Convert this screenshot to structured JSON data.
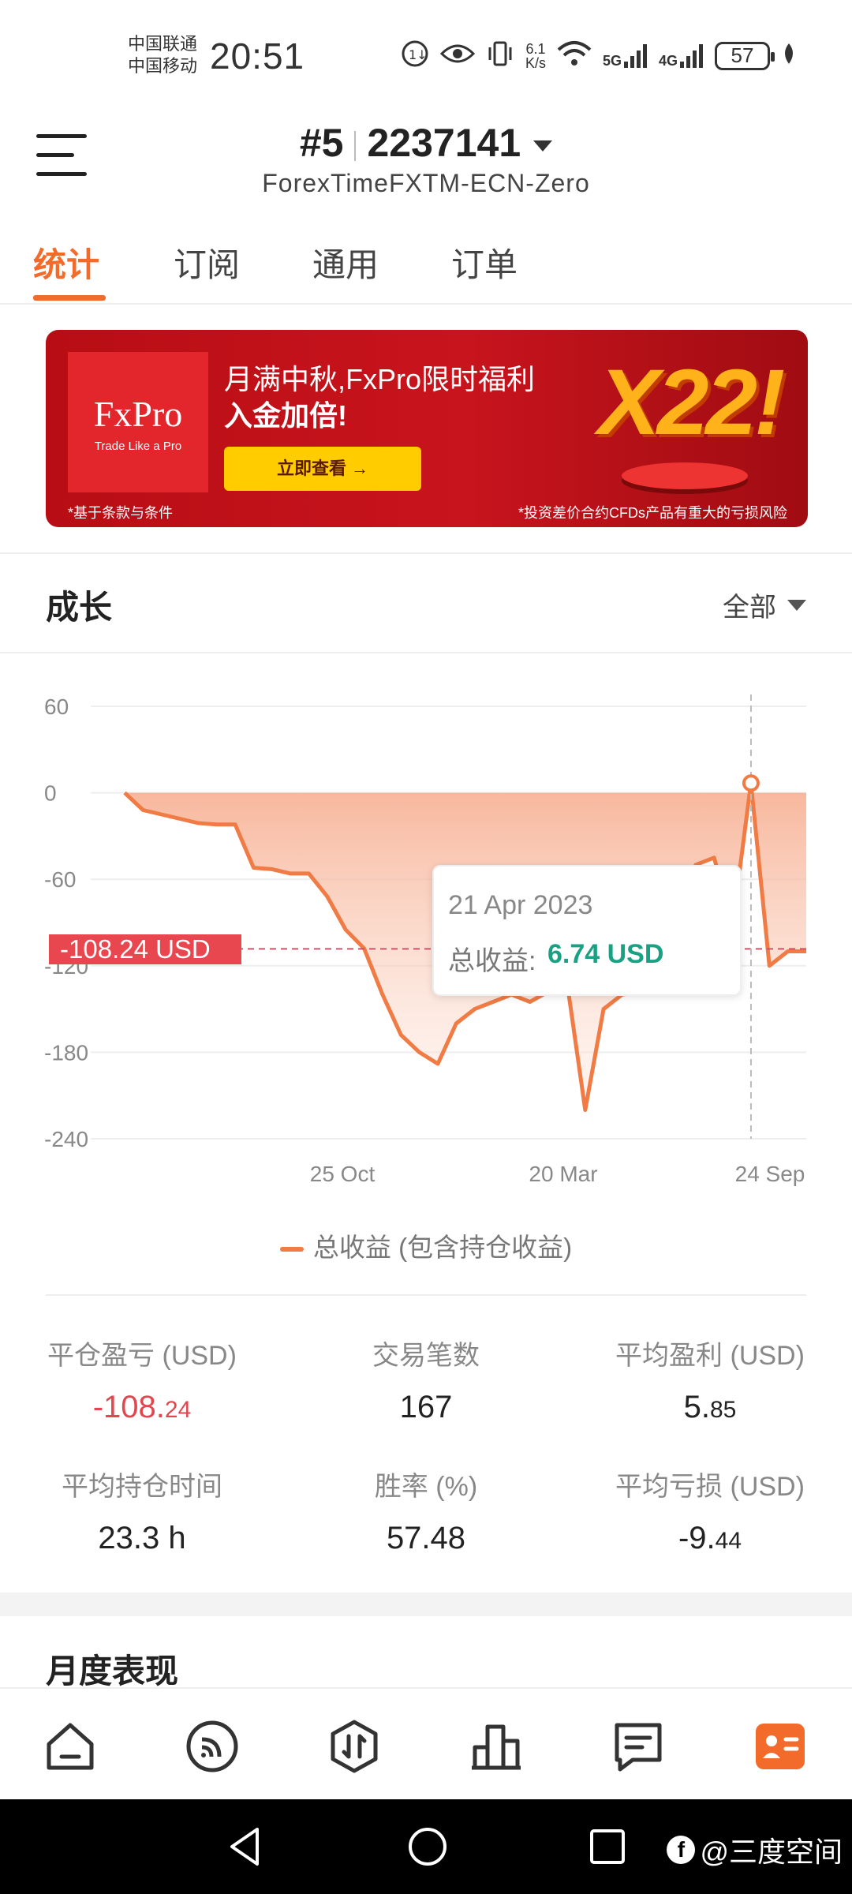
{
  "status_bar": {
    "carrier1": "中国联通",
    "carrier2": "中国移动",
    "time": "20:51",
    "net_speed_value": "6.1",
    "net_speed_unit": "K/s",
    "signal1": "5G",
    "signal2": "4G",
    "battery": "57"
  },
  "header": {
    "account_num": "#5",
    "account_id": "2237141",
    "broker": "ForexTimeFXTM-ECN-Zero"
  },
  "tabs": [
    {
      "label": "统计",
      "active": true
    },
    {
      "label": "订阅",
      "active": false
    },
    {
      "label": "通用",
      "active": false
    },
    {
      "label": "订单",
      "active": false
    }
  ],
  "banner": {
    "logo": "FxPro",
    "logo_tag": "Trade Like a Pro",
    "line1": "月满中秋,FxPro限时福利",
    "line2": "入金加倍!",
    "button": "立即查看 →",
    "terms": "*基于条款与条件",
    "risk": "*投资差价合约CFDs产品有重大的亏损风险",
    "promo": "X22!"
  },
  "growth": {
    "title": "成长",
    "filter": "全部",
    "price_tag": "-108.24 USD",
    "tooltip": {
      "date": "21 Apr 2023",
      "label": "总收益:",
      "value": "6.74 USD"
    },
    "legend": "总收益 (包含持仓收益)"
  },
  "chart_data": {
    "type": "area",
    "title": "",
    "xlabel": "",
    "ylabel": "",
    "ylim": [
      -240,
      60
    ],
    "y_ticks": [
      "60",
      "0",
      "-60",
      "-120",
      "-180",
      "-240"
    ],
    "x_tick_labels": [
      "25 Oct",
      "20 Mar",
      "24 Sep"
    ],
    "grid": true,
    "reference_line": -108.24,
    "highlight": {
      "x_label": "21 Apr 2023",
      "value": 6.74
    },
    "series": [
      {
        "name": "总收益 (包含持仓收益)",
        "color": "#f07b45",
        "values": [
          0,
          -12,
          -15,
          -18,
          -21,
          -22,
          -22,
          -52,
          -53,
          -56,
          -56,
          -72,
          -95,
          -108,
          -140,
          -168,
          -180,
          -188,
          -160,
          -150,
          -145,
          -140,
          -145,
          -138,
          -130,
          -220,
          -150,
          -140,
          -138,
          -132,
          -128,
          -50,
          -45,
          -92,
          6.74,
          -120,
          -110,
          -110
        ]
      }
    ]
  },
  "stats": [
    {
      "label": "平仓盈亏 (USD)",
      "value_main": "-108.",
      "value_small": "24",
      "negative": true
    },
    {
      "label": "交易笔数",
      "value_main": "167",
      "value_small": "",
      "negative": false
    },
    {
      "label": "平均盈利 (USD)",
      "value_main": "5.",
      "value_small": "85",
      "negative": false
    },
    {
      "label": "平均持仓时间",
      "value_main": "23.3 h",
      "value_small": "",
      "negative": false
    },
    {
      "label": "胜率 (%)",
      "value_main": "57.48",
      "value_small": "",
      "negative": false
    },
    {
      "label": "平均亏损 (USD)",
      "value_main": "-9.",
      "value_small": "44",
      "negative": false
    }
  ],
  "monthly": {
    "title": "月度表现"
  },
  "bottom_nav": [
    {
      "icon": "home-icon"
    },
    {
      "icon": "signal-feed-icon"
    },
    {
      "icon": "trade-icon"
    },
    {
      "icon": "chart-bars-icon"
    },
    {
      "icon": "messages-icon"
    },
    {
      "icon": "profile-card-icon",
      "active": true
    }
  ],
  "watermark": "@三度空间",
  "colors": {
    "accent": "#f26b2a",
    "line": "#f07b45",
    "negative": "#e0474f",
    "positive": "#1aa083"
  }
}
